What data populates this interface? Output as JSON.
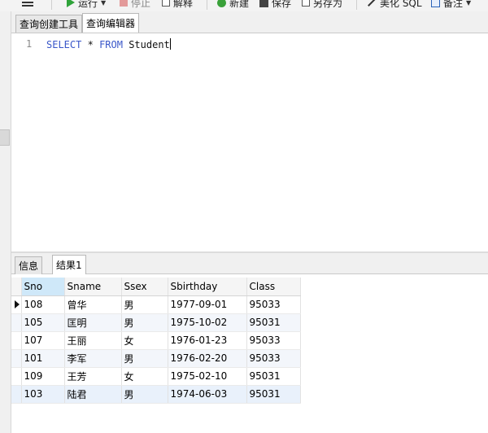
{
  "toolbar": {
    "run_label": "运行",
    "stop_label": "停止",
    "explain_label": "解释",
    "new_label": "新建",
    "save_label": "保存",
    "save_as_label": "另存为",
    "beautify_label": "美化 SQL",
    "comment_label": "备注"
  },
  "editor_tabs": [
    {
      "label": "查询创建工具"
    },
    {
      "label": "查询编辑器"
    }
  ],
  "editor": {
    "line_number": "1",
    "sql": {
      "kw1": "SELECT",
      "star": "*",
      "kw2": "FROM",
      "table": "Student"
    }
  },
  "result_tabs": [
    {
      "label": "信息"
    },
    {
      "label": "结果1"
    }
  ],
  "grid": {
    "columns": [
      "Sno",
      "Sname",
      "Ssex",
      "Sbirthday",
      "Class"
    ],
    "rows": [
      [
        "108",
        "曾华",
        "男",
        "1977-09-01",
        "95033"
      ],
      [
        "105",
        "匡明",
        "男",
        "1975-10-02",
        "95031"
      ],
      [
        "107",
        "王丽",
        "女",
        "1976-01-23",
        "95033"
      ],
      [
        "101",
        "李军",
        "男",
        "1976-02-20",
        "95033"
      ],
      [
        "109",
        "王芳",
        "女",
        "1975-02-10",
        "95031"
      ],
      [
        "103",
        "陆君",
        "男",
        "1974-06-03",
        "95031"
      ]
    ]
  }
}
